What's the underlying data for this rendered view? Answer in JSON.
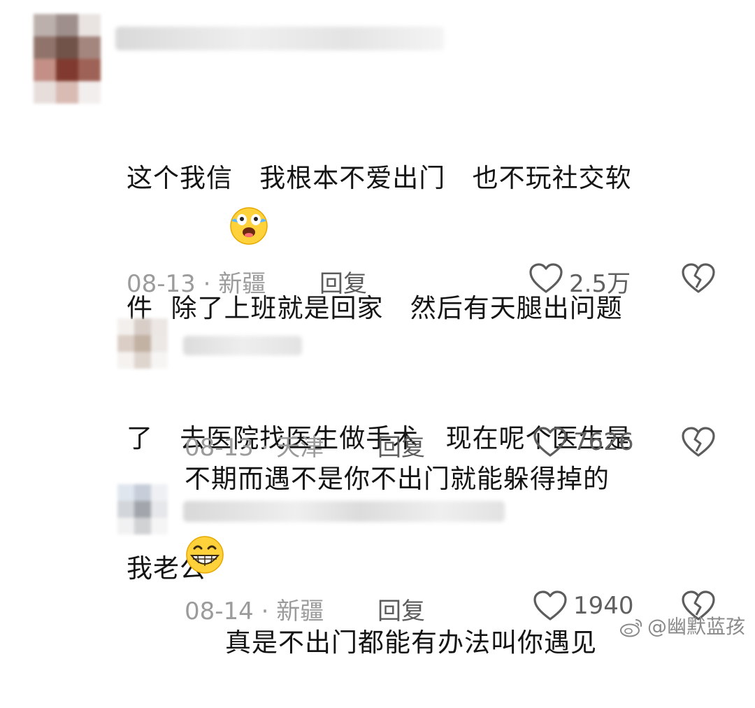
{
  "comments": [
    {
      "lines": [
        "这个我信   我根本不爱出门   也不玩社交软",
        "件  除了上班就是回家   然后有天腿出问题",
        "了   去医院找医生做手术   现在呢个医生是",
        "我老公"
      ],
      "emoji": "crying-laughing-emoji",
      "date": "08-13",
      "location": "新疆",
      "reply_label": "回复",
      "likes": "2.5万"
    },
    {
      "lines": [
        "不期而遇不是你不出门就能躲得掉的"
      ],
      "date": "08-13",
      "location": "天津",
      "reply_label": "回复",
      "likes": "7626"
    },
    {
      "lines": [
        "真是不出门都能有办法叫你遇见"
      ],
      "emoji": "grinning-emoji",
      "date": "08-14",
      "location": "新疆",
      "reply_label": "回复",
      "likes": "1940"
    }
  ],
  "meta_separator": " · ",
  "icons": {
    "like": "heart-outline-icon",
    "dislike": "broken-heart-icon",
    "watermark": "weibo-logo-icon"
  },
  "watermark": {
    "handle": "@幽默蓝孩"
  },
  "colors": {
    "text": "#141414",
    "meta": "#9b9b9b",
    "icon": "#5c5c5c",
    "background": "#ffffff"
  }
}
